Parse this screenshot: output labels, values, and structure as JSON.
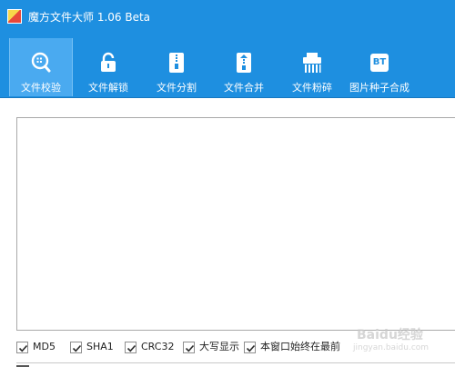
{
  "window": {
    "title": "魔方文件大师 1.06 Beta"
  },
  "toolbar": {
    "items": [
      {
        "label": "文件校验",
        "icon": "magnifier-icon",
        "active": true
      },
      {
        "label": "文件解锁",
        "icon": "unlock-icon",
        "active": false
      },
      {
        "label": "文件分割",
        "icon": "zip-split-icon",
        "active": false
      },
      {
        "label": "文件合并",
        "icon": "zip-merge-icon",
        "active": false
      },
      {
        "label": "文件粉碎",
        "icon": "shredder-icon",
        "active": false
      },
      {
        "label": "图片种子合成",
        "icon": "bt-icon",
        "icon_text": "BT",
        "active": false
      }
    ]
  },
  "main": {
    "text_area_value": "",
    "options": [
      {
        "label": "MD5",
        "checked": true
      },
      {
        "label": "SHA1",
        "checked": true
      },
      {
        "label": "CRC32",
        "checked": true
      },
      {
        "label": "大写显示",
        "checked": true
      },
      {
        "label": "本窗口始终在最前",
        "checked": true
      }
    ]
  },
  "watermark": {
    "text": "Baidu经验",
    "sub": "jingyan.baidu.com"
  },
  "colors": {
    "header_blue": "#1e8fe0",
    "active_tab": "#4aaaf0"
  }
}
